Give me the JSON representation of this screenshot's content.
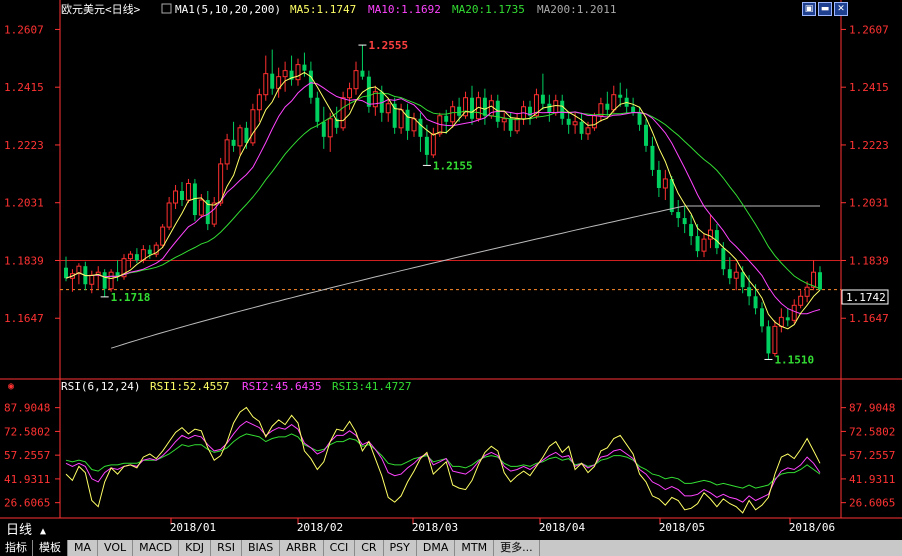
{
  "header": {
    "title": "欧元美元<日线>",
    "ma_label": "MA1(5,10,20,200)",
    "ma5": "MA5:1.1747",
    "ma10": "MA10:1.1692",
    "ma20": "MA20:1.1735",
    "ma200": "MA200:1.2011"
  },
  "rsi_header": {
    "label": "RSI(6,12,24)",
    "rsi1": "RSI1:52.4557",
    "rsi2": "RSI2:45.6435",
    "rsi3": "RSI3:41.4727"
  },
  "price_axis": [
    "1.2607",
    "1.2415",
    "1.2223",
    "1.2031",
    "1.1839",
    "1.1647"
  ],
  "rsi_axis": [
    "87.9048",
    "72.5802",
    "57.2557",
    "41.9311",
    "26.6065"
  ],
  "current_price": "1.1742",
  "annotations": {
    "high": "1.2555",
    "mid_low": "1.2155",
    "left_low": "1.1718",
    "low": "1.1510"
  },
  "x_labels": [
    "2018/01",
    "2018/02",
    "2018/03",
    "2018/04",
    "2018/05",
    "2018/06"
  ],
  "period_label": "日线",
  "tabs": [
    "指标",
    "模板",
    "MA",
    "VOL",
    "MACD",
    "KDJ",
    "RSI",
    "BIAS",
    "ARBR",
    "CCI",
    "CR",
    "PSY",
    "DMA",
    "MTM",
    "更多..."
  ],
  "colors": {
    "up": "#ff3030",
    "down": "#00d060",
    "ma5": "#ffff66",
    "ma10": "#ff44ff",
    "ma20": "#33dd33",
    "ma200": "#bbbbbb",
    "axis": "#ff3333"
  },
  "chart_data": {
    "type": "candlestick",
    "title": "欧元美元<日线>",
    "ylim": [
      1.1455,
      1.2645
    ],
    "rsi_ylim": [
      18,
      98
    ],
    "reference_lines": [
      1.1839,
      1.1742
    ],
    "moving_averages_last": {
      "MA5": 1.1747,
      "MA10": 1.1692,
      "MA20": 1.1735,
      "MA200": 1.2011
    },
    "rsi_last": {
      "RSI1": 52.4557,
      "RSI2": 45.6435,
      "RSI3": 41.4727
    },
    "candles": [
      [
        1.1815,
        1.1852,
        1.177,
        1.178
      ],
      [
        1.178,
        1.181,
        1.1735,
        1.1795
      ],
      [
        1.1795,
        1.183,
        1.176,
        1.182
      ],
      [
        1.182,
        1.1835,
        1.174,
        1.176
      ],
      [
        1.176,
        1.1805,
        1.173,
        1.179
      ],
      [
        1.179,
        1.182,
        1.1745,
        1.18
      ],
      [
        1.18,
        1.181,
        1.1718,
        1.1745
      ],
      [
        1.1745,
        1.181,
        1.1735,
        1.18
      ],
      [
        1.18,
        1.184,
        1.177,
        1.1785
      ],
      [
        1.1785,
        1.186,
        1.1775,
        1.1845
      ],
      [
        1.1845,
        1.187,
        1.1815,
        1.186
      ],
      [
        1.186,
        1.188,
        1.183,
        1.184
      ],
      [
        1.184,
        1.189,
        1.183,
        1.1875
      ],
      [
        1.1875,
        1.189,
        1.1845,
        1.186
      ],
      [
        1.186,
        1.19,
        1.185,
        1.189
      ],
      [
        1.189,
        1.196,
        1.188,
        1.195
      ],
      [
        1.195,
        1.205,
        1.194,
        1.203
      ],
      [
        1.203,
        1.209,
        1.201,
        1.207
      ],
      [
        1.207,
        1.21,
        1.202,
        1.204
      ],
      [
        1.204,
        1.211,
        1.203,
        1.2095
      ],
      [
        1.2095,
        1.211,
        1.197,
        1.199
      ],
      [
        1.199,
        1.206,
        1.198,
        1.204
      ],
      [
        1.204,
        1.207,
        1.194,
        1.196
      ],
      [
        1.196,
        1.205,
        1.195,
        1.203
      ],
      [
        1.203,
        1.218,
        1.202,
        1.216
      ],
      [
        1.216,
        1.226,
        1.214,
        1.224
      ],
      [
        1.224,
        1.23,
        1.22,
        1.222
      ],
      [
        1.222,
        1.229,
        1.219,
        1.228
      ],
      [
        1.228,
        1.23,
        1.221,
        1.223
      ],
      [
        1.223,
        1.236,
        1.222,
        1.234
      ],
      [
        1.234,
        1.241,
        1.23,
        1.239
      ],
      [
        1.239,
        1.252,
        1.237,
        1.246
      ],
      [
        1.246,
        1.254,
        1.239,
        1.241
      ],
      [
        1.241,
        1.248,
        1.238,
        1.245
      ],
      [
        1.245,
        1.25,
        1.24,
        1.247
      ],
      [
        1.247,
        1.252,
        1.242,
        1.244
      ],
      [
        1.244,
        1.251,
        1.242,
        1.249
      ],
      [
        1.249,
        1.253,
        1.245,
        1.247
      ],
      [
        1.247,
        1.25,
        1.236,
        1.238
      ],
      [
        1.238,
        1.24,
        1.228,
        1.23
      ],
      [
        1.23,
        1.235,
        1.221,
        1.225
      ],
      [
        1.225,
        1.233,
        1.22,
        1.231
      ],
      [
        1.231,
        1.235,
        1.226,
        1.228
      ],
      [
        1.228,
        1.24,
        1.227,
        1.238
      ],
      [
        1.238,
        1.243,
        1.234,
        1.241
      ],
      [
        1.241,
        1.25,
        1.239,
        1.247
      ],
      [
        1.247,
        1.2555,
        1.244,
        1.245
      ],
      [
        1.245,
        1.247,
        1.233,
        1.235
      ],
      [
        1.235,
        1.242,
        1.232,
        1.24
      ],
      [
        1.24,
        1.242,
        1.23,
        1.233
      ],
      [
        1.233,
        1.238,
        1.23,
        1.236
      ],
      [
        1.236,
        1.238,
        1.226,
        1.228
      ],
      [
        1.228,
        1.236,
        1.226,
        1.234
      ],
      [
        1.234,
        1.236,
        1.224,
        1.227
      ],
      [
        1.227,
        1.233,
        1.225,
        1.231
      ],
      [
        1.231,
        1.233,
        1.22,
        1.225
      ],
      [
        1.225,
        1.229,
        1.2155,
        1.219
      ],
      [
        1.219,
        1.228,
        1.218,
        1.226
      ],
      [
        1.226,
        1.233,
        1.225,
        1.232
      ],
      [
        1.232,
        1.234,
        1.226,
        1.23
      ],
      [
        1.23,
        1.237,
        1.228,
        1.235
      ],
      [
        1.235,
        1.238,
        1.23,
        1.232
      ],
      [
        1.232,
        1.24,
        1.231,
        1.238
      ],
      [
        1.238,
        1.242,
        1.229,
        1.231
      ],
      [
        1.231,
        1.24,
        1.23,
        1.238
      ],
      [
        1.238,
        1.241,
        1.229,
        1.232
      ],
      [
        1.232,
        1.239,
        1.231,
        1.237
      ],
      [
        1.237,
        1.239,
        1.228,
        1.23
      ],
      [
        1.23,
        1.233,
        1.227,
        1.231
      ],
      [
        1.231,
        1.233,
        1.225,
        1.227
      ],
      [
        1.227,
        1.233,
        1.226,
        1.231
      ],
      [
        1.231,
        1.237,
        1.229,
        1.235
      ],
      [
        1.235,
        1.237,
        1.229,
        1.232
      ],
      [
        1.232,
        1.241,
        1.231,
        1.239
      ],
      [
        1.239,
        1.246,
        1.234,
        1.236
      ],
      [
        1.236,
        1.239,
        1.23,
        1.233
      ],
      [
        1.233,
        1.239,
        1.232,
        1.237
      ],
      [
        1.237,
        1.239,
        1.229,
        1.231
      ],
      [
        1.231,
        1.233,
        1.226,
        1.229
      ],
      [
        1.229,
        1.233,
        1.226,
        1.23
      ],
      [
        1.23,
        1.233,
        1.224,
        1.226
      ],
      [
        1.226,
        1.23,
        1.224,
        1.228
      ],
      [
        1.228,
        1.233,
        1.227,
        1.232
      ],
      [
        1.232,
        1.238,
        1.23,
        1.236
      ],
      [
        1.236,
        1.24,
        1.232,
        1.234
      ],
      [
        1.234,
        1.242,
        1.233,
        1.239
      ],
      [
        1.239,
        1.243,
        1.235,
        1.238
      ],
      [
        1.238,
        1.241,
        1.233,
        1.235
      ],
      [
        1.235,
        1.238,
        1.232,
        1.233
      ],
      [
        1.233,
        1.235,
        1.227,
        1.229
      ],
      [
        1.229,
        1.231,
        1.22,
        1.222
      ],
      [
        1.222,
        1.225,
        1.212,
        1.214
      ],
      [
        1.214,
        1.217,
        1.205,
        1.208
      ],
      [
        1.208,
        1.214,
        1.204,
        1.211
      ],
      [
        1.211,
        1.212,
        1.199,
        1.2
      ],
      [
        1.2,
        1.204,
        1.195,
        1.198
      ],
      [
        1.198,
        1.202,
        1.193,
        1.196
      ],
      [
        1.196,
        1.199,
        1.189,
        1.192
      ],
      [
        1.192,
        1.196,
        1.185,
        1.187
      ],
      [
        1.187,
        1.193,
        1.185,
        1.191
      ],
      [
        1.191,
        1.199,
        1.188,
        1.194
      ],
      [
        1.194,
        1.196,
        1.186,
        1.188
      ],
      [
        1.188,
        1.19,
        1.179,
        1.181
      ],
      [
        1.181,
        1.185,
        1.176,
        1.178
      ],
      [
        1.178,
        1.183,
        1.174,
        1.18
      ],
      [
        1.18,
        1.182,
        1.173,
        1.175
      ],
      [
        1.175,
        1.179,
        1.169,
        1.172
      ],
      [
        1.172,
        1.176,
        1.166,
        1.168
      ],
      [
        1.168,
        1.17,
        1.16,
        1.162
      ],
      [
        1.162,
        1.164,
        1.151,
        1.153
      ],
      [
        1.153,
        1.164,
        1.152,
        1.162
      ],
      [
        1.162,
        1.168,
        1.16,
        1.165
      ],
      [
        1.165,
        1.168,
        1.162,
        1.164
      ],
      [
        1.164,
        1.171,
        1.163,
        1.169
      ],
      [
        1.169,
        1.174,
        1.168,
        1.172
      ],
      [
        1.172,
        1.177,
        1.17,
        1.175
      ],
      [
        1.175,
        1.184,
        1.174,
        1.18
      ],
      [
        1.18,
        1.182,
        1.174,
        1.1742
      ]
    ],
    "rsi1": [
      45,
      41,
      50,
      46,
      28,
      24,
      40,
      49,
      45,
      50,
      51,
      49,
      56,
      58,
      55,
      60,
      66,
      72,
      75,
      71,
      74,
      73,
      62,
      54,
      57,
      66,
      78,
      85,
      88,
      82,
      79,
      69,
      76,
      80,
      77,
      83,
      78,
      60,
      55,
      48,
      53,
      66,
      74,
      73,
      79,
      72,
      60,
      66,
      55,
      44,
      30,
      27,
      31,
      40,
      47,
      55,
      59,
      45,
      49,
      53,
      38,
      36,
      35,
      41,
      51,
      59,
      63,
      60,
      46,
      40,
      44,
      47,
      44,
      50,
      56,
      63,
      66,
      59,
      63,
      48,
      52,
      46,
      50,
      60,
      62,
      68,
      70,
      64,
      58,
      45,
      40,
      31,
      29,
      25,
      30,
      28,
      22,
      23,
      26,
      33,
      29,
      24,
      29,
      26,
      24,
      20,
      28,
      22,
      25,
      30,
      45,
      56,
      58,
      55,
      61,
      68,
      60,
      52
    ],
    "rsi2": [
      52,
      50,
      52,
      50,
      42,
      40,
      46,
      49,
      48,
      50,
      51,
      50,
      54,
      55,
      54,
      57,
      61,
      66,
      70,
      68,
      70,
      69,
      64,
      60,
      61,
      65,
      71,
      76,
      79,
      77,
      75,
      70,
      73,
      75,
      74,
      77,
      74,
      65,
      62,
      58,
      60,
      66,
      70,
      70,
      73,
      70,
      64,
      66,
      61,
      55,
      46,
      44,
      45,
      49,
      52,
      56,
      58,
      51,
      53,
      55,
      47,
      46,
      45,
      48,
      53,
      57,
      59,
      57,
      50,
      47,
      48,
      50,
      48,
      51,
      54,
      57,
      59,
      56,
      57,
      50,
      52,
      49,
      51,
      56,
      57,
      60,
      61,
      58,
      55,
      48,
      45,
      40,
      38,
      35,
      37,
      35,
      31,
      31,
      32,
      35,
      33,
      30,
      32,
      30,
      29,
      27,
      31,
      28,
      30,
      32,
      41,
      47,
      49,
      48,
      51,
      56,
      52,
      46
    ],
    "rsi3": [
      54,
      53,
      54,
      53,
      48,
      47,
      50,
      51,
      51,
      52,
      52,
      52,
      54,
      54,
      54,
      56,
      58,
      61,
      64,
      63,
      64,
      64,
      61,
      59,
      60,
      62,
      66,
      69,
      71,
      70,
      69,
      66,
      68,
      69,
      69,
      71,
      69,
      64,
      62,
      60,
      61,
      64,
      66,
      66,
      68,
      67,
      63,
      64,
      61,
      57,
      52,
      51,
      51,
      53,
      55,
      56,
      57,
      53,
      54,
      55,
      50,
      50,
      49,
      51,
      54,
      56,
      57,
      56,
      52,
      50,
      50,
      51,
      50,
      52,
      53,
      55,
      56,
      54,
      55,
      51,
      52,
      50,
      51,
      54,
      55,
      57,
      57,
      56,
      54,
      50,
      48,
      45,
      44,
      42,
      43,
      42,
      39,
      39,
      40,
      41,
      40,
      38,
      39,
      38,
      37,
      36,
      38,
      36,
      37,
      38,
      42,
      45,
      46,
      46,
      48,
      51,
      48,
      45
    ]
  }
}
